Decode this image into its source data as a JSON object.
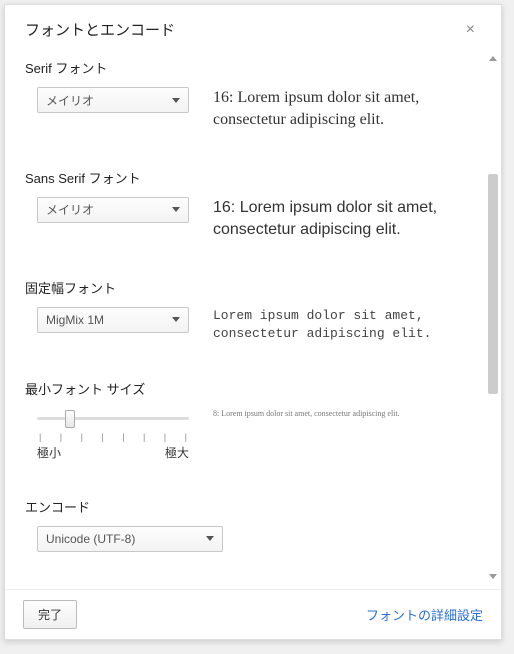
{
  "dialog": {
    "title": "フォントとエンコード",
    "close": "×"
  },
  "serif": {
    "label": "Serif フォント",
    "value": "メイリオ",
    "preview": "16: Lorem ipsum dolor sit amet, consectetur adipiscing elit."
  },
  "sans": {
    "label": "Sans Serif フォント",
    "value": "メイリオ",
    "preview": "16: Lorem ipsum dolor sit amet, consectetur adipiscing elit."
  },
  "mono": {
    "label": "固定幅フォント",
    "value": "MigMix 1M",
    "preview": "Lorem ipsum dolor sit amet, consectetur adipiscing elit."
  },
  "minsize": {
    "label": "最小フォント サイズ",
    "min_label": "極小",
    "max_label": "極大",
    "preview": "8: Lorem ipsum dolor sit amet, consectetur adipiscing elit."
  },
  "encoding": {
    "label": "エンコード",
    "value": "Unicode (UTF-8)"
  },
  "footer": {
    "done": "完了",
    "advanced": "フォントの詳細設定"
  }
}
